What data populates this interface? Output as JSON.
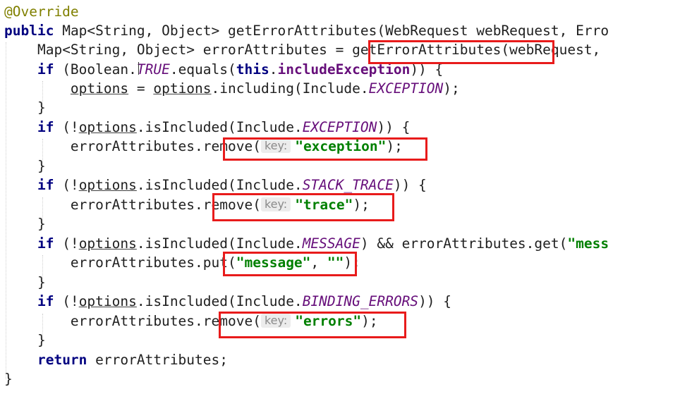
{
  "code": {
    "annotation": "@Override",
    "kw_public": "public",
    "map_type": "Map<String, Object>",
    "method_name": "getErrorAttributes",
    "params_visible": "(WebRequest webRequest, Erro",
    "l2_decl": "Map<String, Object> errorAttributes ",
    "l2_eq": "= ",
    "l2_call": "getErrorAttributes",
    "l2_rest": "(webRequest,",
    "kw_if": "if",
    "l3_open": " (Boolean.",
    "true_const": "TRUE",
    "l3_equals": ".equals(",
    "kw_this": "this",
    "dot": ".",
    "include_exception_field": "includeException",
    "l3_close": ")) {",
    "options": "options",
    "l4_eq": " = ",
    "l4_including": ".including(Include.",
    "const_exception": "EXCEPTION",
    "l4_close": ");",
    "brace_close": "}",
    "cond_open": " (!",
    "is_included": ".isIncluded(Include.",
    "cond_close": ")) {",
    "error_attributes": "errorAttributes",
    "remove_open": "remove(",
    "hint_key": "key:",
    "str_exception": "\"exception\"",
    "stmt_close": ");",
    "const_stack_trace": "STACK_TRACE",
    "remove_dot_open": ".remove(",
    "str_trace": "\"trace\"",
    "const_message": "MESSAGE",
    "l13_mid": ") && errorAttributes.get(",
    "str_mess": "\"mess",
    "put_open": "put(",
    "str_message": "\"message\"",
    "comma": ", ",
    "str_empty": "\"\"",
    "const_binding_errors": "BINDING_ERRORS",
    "str_errors": "\"errors\"",
    "kw_return": "return",
    "return_rest": " errorAttributes;"
  },
  "colors": {
    "highlight_box": "#e81b1b",
    "keyword": "#000080",
    "string": "#008000",
    "constant": "#660e7a",
    "annotation": "#808000"
  }
}
